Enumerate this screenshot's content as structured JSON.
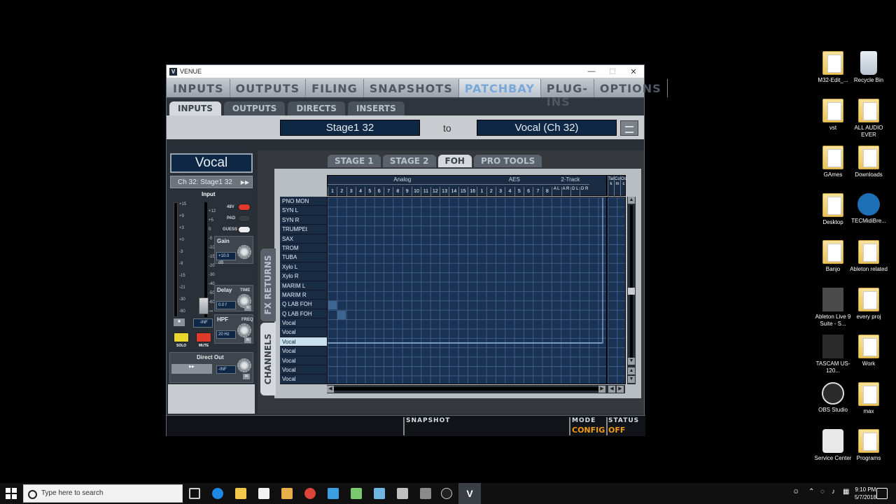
{
  "window": {
    "title": "VENUE",
    "controls": {
      "minimize": "—",
      "maximize": "☐",
      "close": "✕"
    }
  },
  "main_tabs": [
    {
      "label": "INPUTS",
      "active": false
    },
    {
      "label": "OUTPUTS",
      "active": false
    },
    {
      "label": "FILING",
      "active": false
    },
    {
      "label": "SNAPSHOTS",
      "active": false
    },
    {
      "label": "PATCHBAY",
      "active": true
    },
    {
      "label": "PLUG-INS",
      "active": false
    },
    {
      "label": "OPTIONS",
      "active": false
    }
  ],
  "sub_tabs": [
    {
      "label": "INPUTS",
      "active": true
    },
    {
      "label": "OUTPUTS",
      "active": false
    },
    {
      "label": "DIRECTS",
      "active": false
    },
    {
      "label": "INSERTS",
      "active": false
    }
  ],
  "route": {
    "source": "Stage1 32",
    "to": "to",
    "destination": "Vocal (Ch 32)"
  },
  "strip": {
    "channel_name": "Vocal",
    "channel_source": "Ch 32: Stage1 32",
    "input_label": "Input",
    "phantom_label": "48V",
    "pad_label": "PAD",
    "guess_label": "GUESS",
    "meter_scale": [
      "+15",
      "+9",
      "+3",
      "+0",
      "-3",
      "-9",
      "-15",
      "-21",
      "-30",
      "-60"
    ],
    "fader_scale": [
      "+12",
      "+5",
      "0",
      "-5",
      "-10",
      "-15",
      "-20",
      "-30",
      "-40",
      "-50",
      "-60",
      "-∞"
    ],
    "fader_value": "-INF",
    "gain_label": "Gain",
    "gain_value": "+10.0 dB",
    "delay_label": "Delay",
    "delay_time_label": "TIME",
    "delay_value": "0.0 f",
    "delay_in": "IN",
    "hpf_label": "HPF",
    "hpf_freq_label": "FREQ",
    "hpf_value": "20 Hz",
    "hpf_in": "IN",
    "solo_label": "SOLO",
    "mute_label": "MUTE",
    "direct_out_label": "Direct Out",
    "direct_out_value": "-INF",
    "direct_out_in": "IN"
  },
  "source_tabs": [
    {
      "label": "STAGE 1",
      "active": false
    },
    {
      "label": "STAGE 2",
      "active": false
    },
    {
      "label": "FOH",
      "active": true
    },
    {
      "label": "PRO TOOLS",
      "active": false
    }
  ],
  "side_tabs": [
    {
      "label": "FX RETURNS",
      "active": false
    },
    {
      "label": "CHANNELS",
      "active": true
    }
  ],
  "grid": {
    "groups": [
      {
        "label": "Analog",
        "columns": [
          "1",
          "2",
          "3",
          "4",
          "5",
          "6",
          "7",
          "8",
          "9",
          "10",
          "11",
          "12",
          "13",
          "14",
          "15",
          "16"
        ]
      },
      {
        "label": "AES",
        "columns": [
          "1",
          "2",
          "3",
          "4",
          "5",
          "6",
          "7",
          "8"
        ]
      },
      {
        "label": "2-Track",
        "columns": [
          "A L",
          "A R",
          "D L",
          "D R"
        ]
      }
    ],
    "side_columns": [
      "Talk",
      "Com",
      "Osc"
    ],
    "rows": [
      "PNO MON",
      "SYN L",
      "SYN R",
      "TRUMPEt",
      "SAX",
      "TROM",
      "TUBA",
      "Xylo L",
      "Xylo R",
      "MARIM L",
      "MARIM R",
      "Q LAB FOH",
      "Q LAB FOH",
      "Vocal",
      "Vocal",
      "Vocal",
      "Vocal",
      "Vocal",
      "Vocal",
      "Vocal"
    ],
    "selected_row": 15,
    "patched": [
      {
        "row": 11,
        "col": 0
      },
      {
        "row": 12,
        "col": 1
      }
    ],
    "colors": {
      "grid_bg": "#1a3253",
      "patch": "#3d6591",
      "highlight": "#8fb3d9"
    }
  },
  "status": {
    "snapshot_label": "SNAPSHOT",
    "mode_label": "MODE",
    "mode_value": "CONFIG",
    "status_label": "STATUS",
    "status_value": "OFF",
    "accent": "#f09a1a"
  },
  "desktop_icons": [
    {
      "label": "M32-Edit_...",
      "icon": "folder-icon"
    },
    {
      "label": "Recycle Bin",
      "icon": "recycle-bin-icon"
    },
    {
      "label": "vst",
      "icon": "folder-icon"
    },
    {
      "label": "ALL AUDIO EVER",
      "icon": "folder-icon"
    },
    {
      "label": "GAmes",
      "icon": "folder-icon"
    },
    {
      "label": "Downloads",
      "icon": "folder-icon"
    },
    {
      "label": "Desktop",
      "icon": "folder-icon"
    },
    {
      "label": "TECMidiBre...",
      "icon": "tec-app-icon"
    },
    {
      "label": "Banjo",
      "icon": "folder-icon"
    },
    {
      "label": "Ableton related",
      "icon": "folder-icon"
    },
    {
      "label": "Ableton Live 9 Suite - S...",
      "icon": "ableton-icon"
    },
    {
      "label": "every proj",
      "icon": "folder-icon"
    },
    {
      "label": "TASCAM US-120...",
      "icon": "tascam-icon"
    },
    {
      "label": "Work",
      "icon": "folder-icon"
    },
    {
      "label": "OBS Studio",
      "icon": "obs-icon"
    },
    {
      "label": "max",
      "icon": "folder-icon"
    },
    {
      "label": "Service Center",
      "icon": "service-center-icon"
    },
    {
      "label": "Programs",
      "icon": "folder-icon"
    }
  ],
  "taskbar": {
    "search_placeholder": "Type here to search",
    "time": "9:10 PM",
    "date": "5/7/2018"
  }
}
